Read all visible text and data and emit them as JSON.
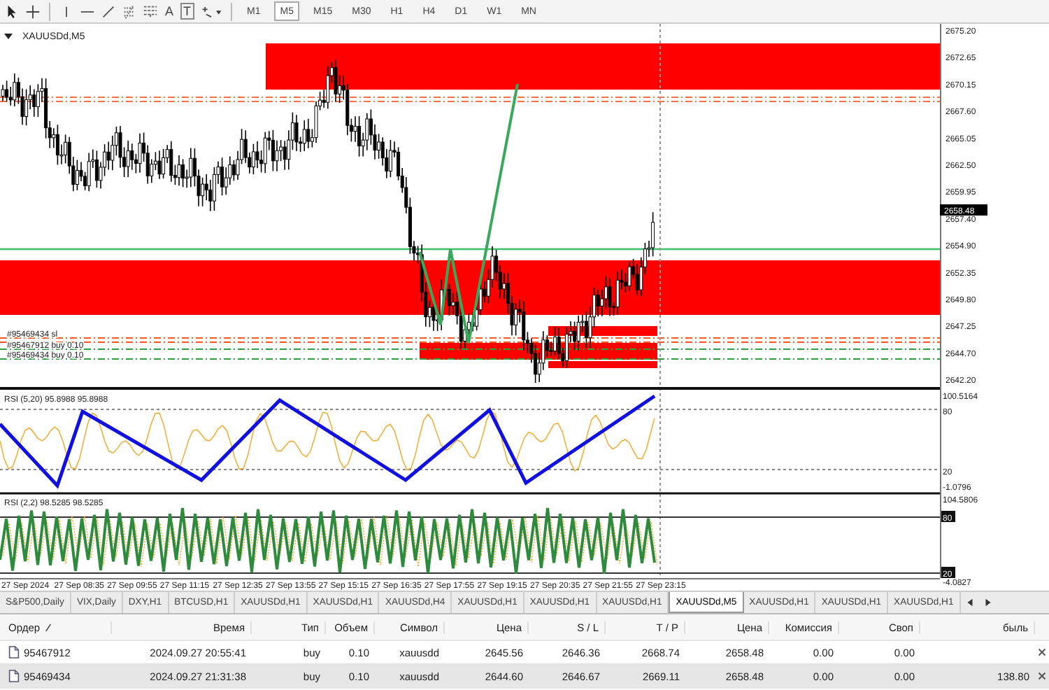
{
  "toolbar": {
    "tool_glyphs": [
      "A",
      "T"
    ],
    "timeframes": [
      {
        "label": "M1",
        "selected": false
      },
      {
        "label": "M5",
        "selected": true
      },
      {
        "label": "M15",
        "selected": false
      },
      {
        "label": "M30",
        "selected": false
      },
      {
        "label": "H1",
        "selected": false
      },
      {
        "label": "H4",
        "selected": false
      },
      {
        "label": "D1",
        "selected": false
      },
      {
        "label": "W1",
        "selected": false
      },
      {
        "label": "MN",
        "selected": false
      }
    ]
  },
  "chart": {
    "symbol": "XAUUSDd,M5",
    "price_labels": [
      "2675.20",
      "2672.65",
      "2670.15",
      "2667.60",
      "2665.05",
      "2662.50",
      "2659.95",
      "2657.40",
      "2654.90",
      "2652.35",
      "2649.80",
      "2647.25",
      "2644.70",
      "2642.20"
    ],
    "current_price": "2658.48",
    "order_labels": [
      "#95469434 sl",
      "#95467912 buy 0.10",
      "#95469434 buy 0.10"
    ],
    "time_labels": [
      "27 Sep 2024",
      "27 Sep 08:35",
      "27 Sep 09:55",
      "27 Sep 11:15",
      "27 Sep 12:35",
      "27 Sep 13:55",
      "27 Sep 15:15",
      "27 Sep 16:35",
      "27 Sep 17:55",
      "27 Sep 19:15",
      "27 Sep 20:35",
      "27 Sep 21:55",
      "27 Sep 23:15"
    ]
  },
  "indicators": [
    {
      "title": "RSI (5,20) 95.8988 95.8988",
      "scale_labels": [
        {
          "text": "100.5164",
          "boxed": false
        },
        {
          "text": "80",
          "boxed": false
        },
        {
          "text": "20",
          "boxed": false
        },
        {
          "text": "-1.0796",
          "boxed": false
        }
      ]
    },
    {
      "title": "RSI (2,2) 98.5285 98.5285",
      "scale_labels": [
        {
          "text": "104.5806",
          "boxed": false
        },
        {
          "text": "80",
          "boxed": true
        },
        {
          "text": "20",
          "boxed": true
        },
        {
          "text": "-4.0827",
          "boxed": false
        }
      ]
    }
  ],
  "tabs": [
    {
      "label": "S&P500,Daily",
      "selected": false
    },
    {
      "label": "VIX,Daily",
      "selected": false
    },
    {
      "label": "DXY,H1",
      "selected": false
    },
    {
      "label": "BTCUSD,H1",
      "selected": false
    },
    {
      "label": "XAUUSDd,H1",
      "selected": false
    },
    {
      "label": "XAUUSDd,H1",
      "selected": false
    },
    {
      "label": "XAUUSDd,H4",
      "selected": false
    },
    {
      "label": "XAUUSDd,H1",
      "selected": false
    },
    {
      "label": "XAUUSDd,H1",
      "selected": false
    },
    {
      "label": "XAUUSDd,H1",
      "selected": false
    },
    {
      "label": "XAUUSDd,M5",
      "selected": true
    },
    {
      "label": "XAUUSDd,H1",
      "selected": false
    },
    {
      "label": "XAUUSDd,H1",
      "selected": false
    },
    {
      "label": "XAUUSDd,H1",
      "selected": false
    }
  ],
  "trade_table": {
    "columns": [
      "Ордер",
      "Время",
      "Тип",
      "Объем",
      "Символ",
      "Цена",
      "S / L",
      "T / P",
      "Цена",
      "Комиссия",
      "Своп",
      "быль"
    ],
    "rows": [
      {
        "selected": false,
        "cells": [
          "95467912",
          "2024.09.27 20:55:41",
          "buy",
          "0.10",
          "xauusdd",
          "2645.56",
          "2646.36",
          "2668.74",
          "2658.48",
          "0.00",
          "0.00"
        ]
      },
      {
        "selected": true,
        "cells": [
          "95469434",
          "2024.09.27 21:31:38",
          "buy",
          "0.10",
          "xauusdd",
          "2644.60",
          "2646.67",
          "2669.11",
          "2658.48",
          "0.00",
          "0.00",
          "138.80"
        ]
      }
    ]
  }
}
